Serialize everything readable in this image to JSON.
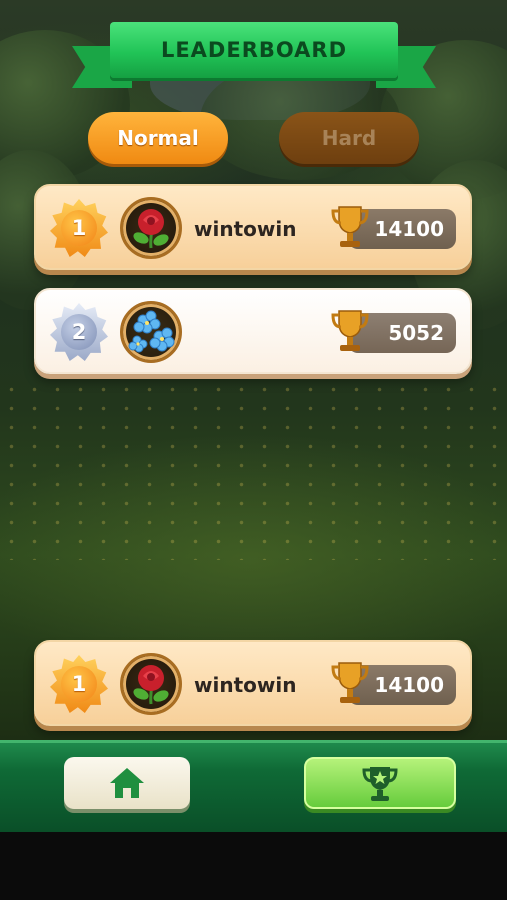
{
  "banner": {
    "title": "LEADERBOARD"
  },
  "tabs": [
    {
      "label": "Normal",
      "active": true
    },
    {
      "label": "Hard",
      "active": false
    }
  ],
  "leaderboard": [
    {
      "rank": "1",
      "medal": "gold-medal-icon",
      "avatar": "red-rose-icon",
      "name": "wintowin",
      "score": "14100"
    },
    {
      "rank": "2",
      "medal": "silver-medal-icon",
      "avatar": "blue-forget-me-not-icon",
      "name": "",
      "score": "5052"
    }
  ],
  "current_player": {
    "rank": "1",
    "medal": "gold-medal-icon",
    "avatar": "red-rose-icon",
    "name": "wintowin",
    "score": "14100"
  },
  "bottom_nav": [
    {
      "icon": "home-icon",
      "active": false
    },
    {
      "icon": "trophy-star-icon",
      "active": true
    }
  ],
  "colors": {
    "banner_green": "#21c457",
    "tab_active": "#f08a12",
    "tab_inactive": "#6e3f0f",
    "row_gold_bg": "#f7d09a",
    "row_silver_bg": "#fbf0e3",
    "nav_bar": "#0f6a36",
    "nav_active": "#66cc3c"
  }
}
